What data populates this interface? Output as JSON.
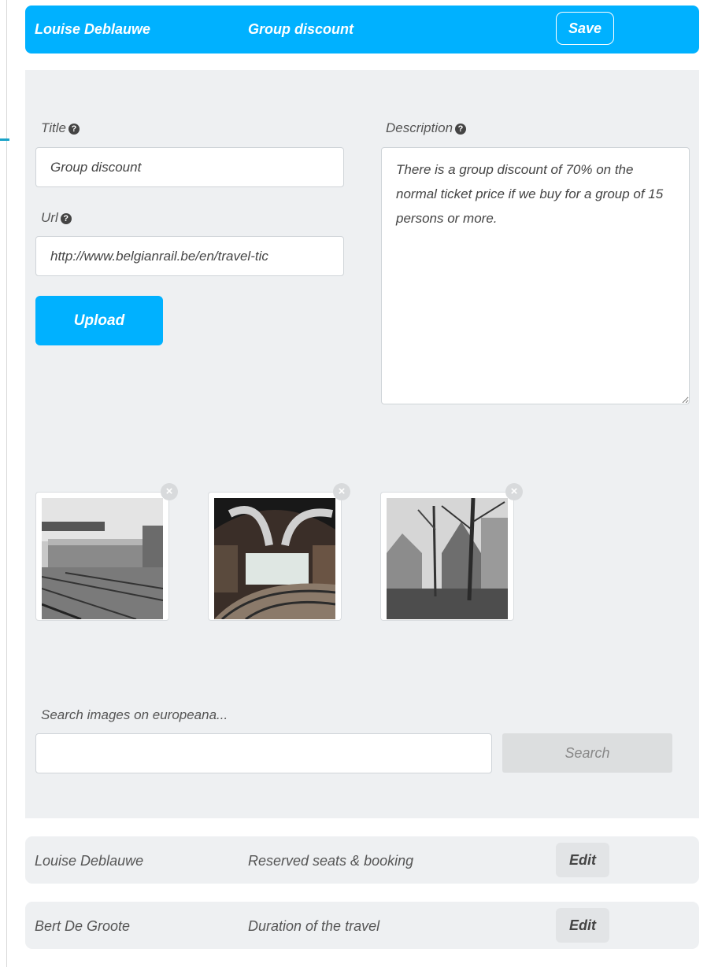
{
  "header": {
    "name": "Louise Deblauwe",
    "topic": "Group discount",
    "save_label": "Save"
  },
  "form": {
    "title_label": "Title",
    "title_value": "Group discount",
    "url_label": "Url",
    "url_value": "http://www.belgianrail.be/en/travel-tic",
    "upload_label": "Upload",
    "description_label": "Description",
    "description_value": "There is a group discount of 70% on the normal ticket price if we buy for a group of 15 persons or more.",
    "help_icon": "question-circle-icon",
    "remove_icon": "close-circle-icon"
  },
  "images": [
    {
      "name": "train-photo"
    },
    {
      "name": "station-hall-photo"
    },
    {
      "name": "trees-houses-photo"
    }
  ],
  "search": {
    "label": "Search images on europeana...",
    "value": "",
    "button_label": "Search"
  },
  "items": [
    {
      "name": "Louise Deblauwe",
      "topic": "Reserved seats & booking",
      "edit_label": "Edit"
    },
    {
      "name": "Bert De Groote",
      "topic": "Duration of the travel",
      "edit_label": "Edit"
    }
  ],
  "colors": {
    "accent": "#00b1ff",
    "panel": "#eef0f2"
  }
}
